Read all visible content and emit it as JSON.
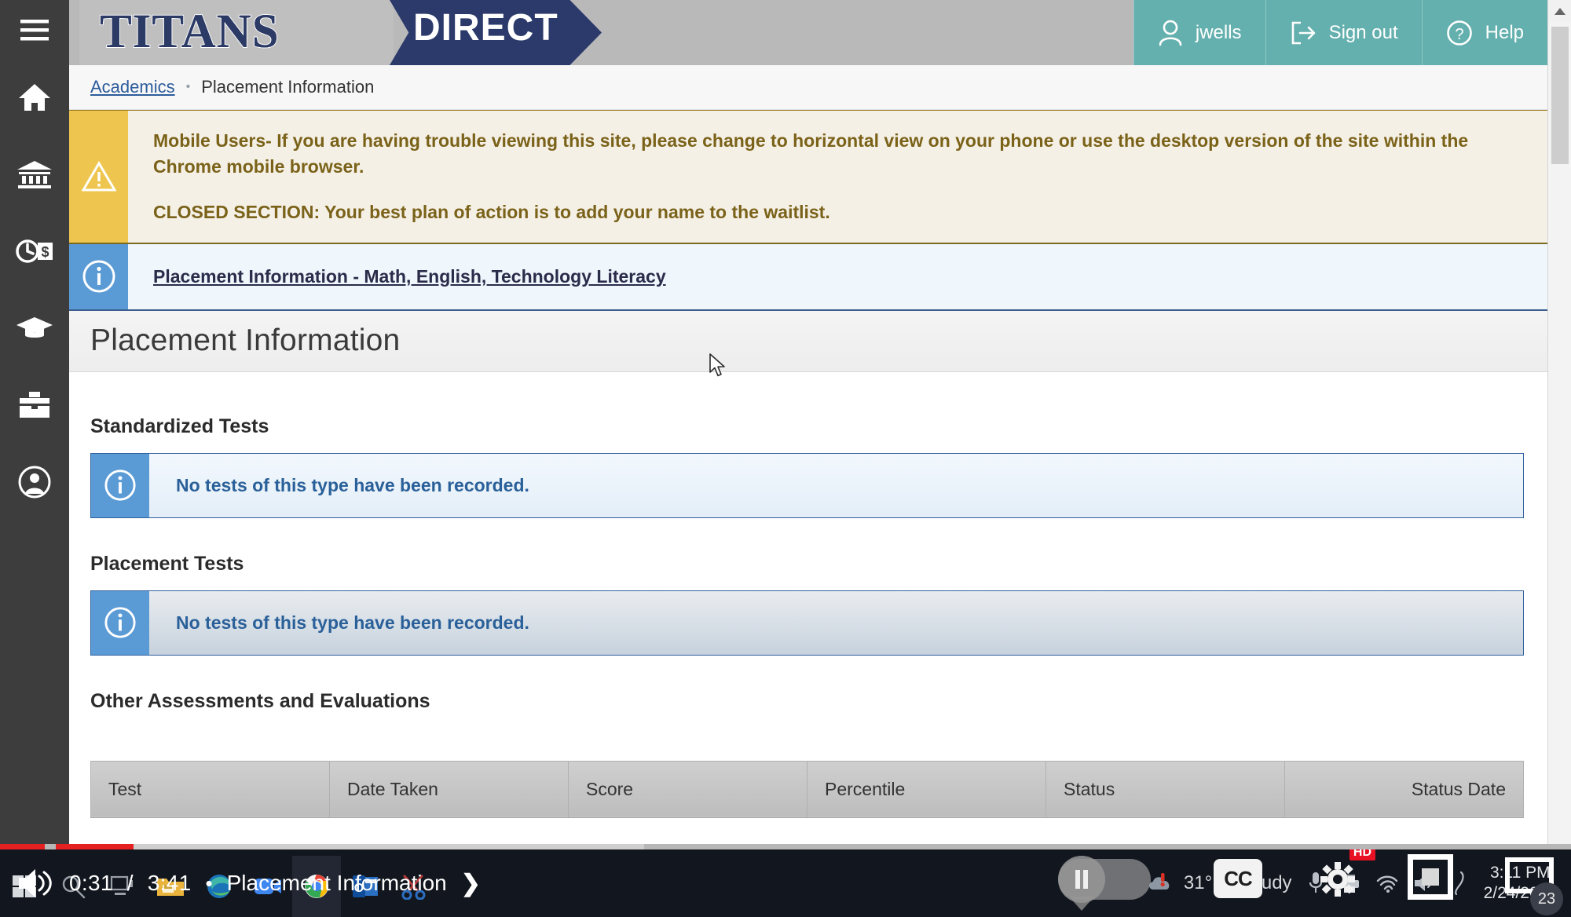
{
  "header": {
    "logo_primary": "TITANS",
    "logo_secondary": "DIRECT",
    "actions": [
      {
        "icon": "user-icon",
        "label": "jwells"
      },
      {
        "icon": "sign-out-icon",
        "label": "Sign out"
      },
      {
        "icon": "help-circle-icon",
        "label": "Help"
      }
    ]
  },
  "sidebar": {
    "items": [
      {
        "icon": "hamburger-menu-icon",
        "name": "menu"
      },
      {
        "icon": "home-icon",
        "name": "home"
      },
      {
        "icon": "institution-icon",
        "name": "institution"
      },
      {
        "icon": "financial-aid-icon",
        "name": "financial-aid"
      },
      {
        "icon": "graduation-cap-icon",
        "name": "academics"
      },
      {
        "icon": "toolbox-icon",
        "name": "resources"
      },
      {
        "icon": "user-circle-icon",
        "name": "profile"
      }
    ]
  },
  "breadcrumb": {
    "parent": "Academics",
    "separator": "•",
    "current": "Placement Information"
  },
  "alerts": {
    "warning": {
      "icon": "warning-triangle-icon",
      "line1": "Mobile Users- If you are having trouble viewing this site, please change to horizontal view on your phone or use the desktop version of the site within the Chrome mobile browser.",
      "line2": "CLOSED SECTION: Your best plan of action is to add your name to the waitlist."
    },
    "info": {
      "icon": "info-circle-icon",
      "link": "Placement Information - Math, English, Technology Literacy"
    }
  },
  "page": {
    "title": "Placement Information",
    "sections": [
      {
        "heading": "Standardized Tests",
        "empty_message": "No tests of this type have been recorded."
      },
      {
        "heading": "Placement Tests",
        "empty_message": "No tests of this type have been recorded."
      }
    ],
    "table_section": {
      "heading": "Other Assessments and Evaluations",
      "columns": [
        "Test",
        "Date Taken",
        "Score",
        "Percentile",
        "Status",
        "Status Date"
      ],
      "rows": []
    }
  },
  "player": {
    "current_time": "0:31",
    "duration": "3:41",
    "separator": "/",
    "bullet": "•",
    "title": "Placement Information",
    "next_icon": "next-chevron-icon",
    "volume_icon": "volume-icon",
    "pause_icon": "pause-icon",
    "cc_label": "CC",
    "hd_badge": "HD",
    "quality_icon": "gear-icon"
  },
  "taskbar": {
    "apps": [
      {
        "name": "start-button"
      },
      {
        "name": "search-icon"
      },
      {
        "name": "task-view-icon"
      },
      {
        "name": "file-explorer-icon"
      },
      {
        "name": "edge-icon"
      },
      {
        "name": "zoom-icon"
      },
      {
        "name": "chrome-icon"
      },
      {
        "name": "outlook-icon"
      },
      {
        "name": "snip-tool-icon"
      }
    ],
    "weather": {
      "temperature": "31°F",
      "condition": "Cloudy",
      "icon": "cloud-alert-icon"
    },
    "clock": {
      "time": "3:11 PM",
      "date": "2/24/2022"
    },
    "notification_count": "23"
  },
  "colors": {
    "header_teal": "#64b0ae",
    "logo_navy": "#2b3a6b",
    "warning_bar": "#eec64f",
    "info_bar": "#5b9bd5",
    "link_blue": "#2c5c9a",
    "progress_red": "#e52020"
  }
}
